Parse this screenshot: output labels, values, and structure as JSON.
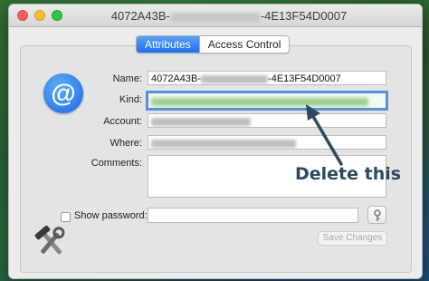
{
  "window": {
    "title_prefix": "4072A43B-",
    "title_suffix": "-4E13F54D0007"
  },
  "tabs": [
    {
      "label": "Attributes",
      "active": true
    },
    {
      "label": "Access Control",
      "active": false
    }
  ],
  "icon": {
    "name": "at-icon",
    "glyph": "@"
  },
  "form": {
    "name_label": "Name:",
    "name_prefix": "4072A43B-",
    "name_suffix": "-4E13F54D0007",
    "kind_label": "Kind:",
    "account_label": "Account:",
    "where_label": "Where:",
    "comments_label": "Comments:",
    "show_password_label": "Show password:",
    "show_password_checked": false,
    "save_label": "Save Changes"
  },
  "annotation": {
    "text": "Delete this",
    "color": "#2d4a5e"
  },
  "colors": {
    "accent": "#1d6ef0",
    "highlight_border": "#5a8fe0"
  }
}
